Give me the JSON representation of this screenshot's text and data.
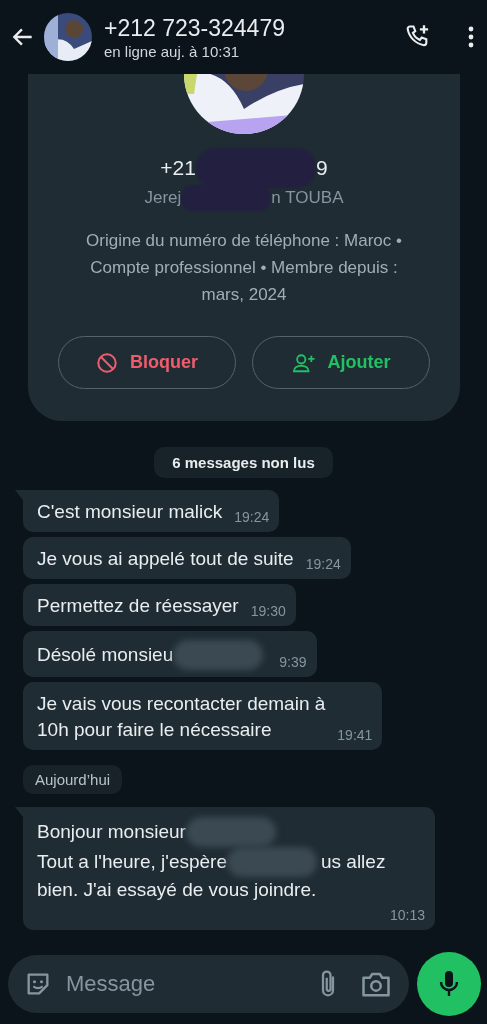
{
  "header": {
    "title": "+212 723-324479",
    "status": "en ligne auj. à 10:31"
  },
  "profile": {
    "phone_parts": [
      {
        "kind": "text",
        "text": "+21"
      },
      {
        "kind": "redacted"
      },
      {
        "kind": "text",
        "text": "9"
      }
    ],
    "name_parts": [
      {
        "kind": "text",
        "text": "Jerej"
      },
      {
        "kind": "redacted"
      },
      {
        "kind": "text",
        "text": "n TOUBA"
      }
    ],
    "details": "Origine du numéro de téléphone : Maroc • Compte professionnel • Membre depuis : mars, 2024",
    "actions": [
      {
        "kind": "block",
        "label": "Bloquer"
      },
      {
        "kind": "add",
        "label": "Ajouter"
      }
    ]
  },
  "unread_banner": "6 messages non lus",
  "messages": [
    {
      "lines": [
        [
          {
            "kind": "text",
            "text": "C'est  monsieur malick"
          }
        ]
      ],
      "time": "19:24",
      "tail": true
    },
    {
      "lines": [
        [
          {
            "kind": "text",
            "text": "Je vous ai appelé tout de suite"
          }
        ]
      ],
      "time": "19:24",
      "tail": false
    },
    {
      "lines": [
        [
          {
            "kind": "text",
            "text": "Permettez de réessayer"
          }
        ]
      ],
      "time": "19:30",
      "tail": false
    },
    {
      "lines": [
        [
          {
            "kind": "text",
            "text": "Désolé monsieu"
          },
          {
            "kind": "redacted"
          }
        ]
      ],
      "time": "9:39",
      "tail": false
    },
    {
      "lines": [
        [
          {
            "kind": "text",
            "text": "Je vais vous recontacter demain à"
          }
        ],
        [
          {
            "kind": "text",
            "text": "10h pour faire le nécessaire"
          }
        ]
      ],
      "time": "19:41",
      "tail": false
    },
    {
      "kind": "date",
      "label": "Aujourd’hui"
    },
    {
      "lines": [
        [
          {
            "kind": "text",
            "text": "Bonjour monsieur"
          },
          {
            "kind": "redacted"
          }
        ],
        [
          {
            "kind": "text",
            "text": "Tout a l'heure, j'espère"
          },
          {
            "kind": "redacted"
          },
          {
            "kind": "text",
            "text": "us allez"
          }
        ],
        [
          {
            "kind": "text",
            "text": "bien. J'ai essayé de vous joindre."
          }
        ]
      ],
      "time": "10:13",
      "tail": true
    }
  ],
  "composer": {
    "placeholder": "Message"
  }
}
